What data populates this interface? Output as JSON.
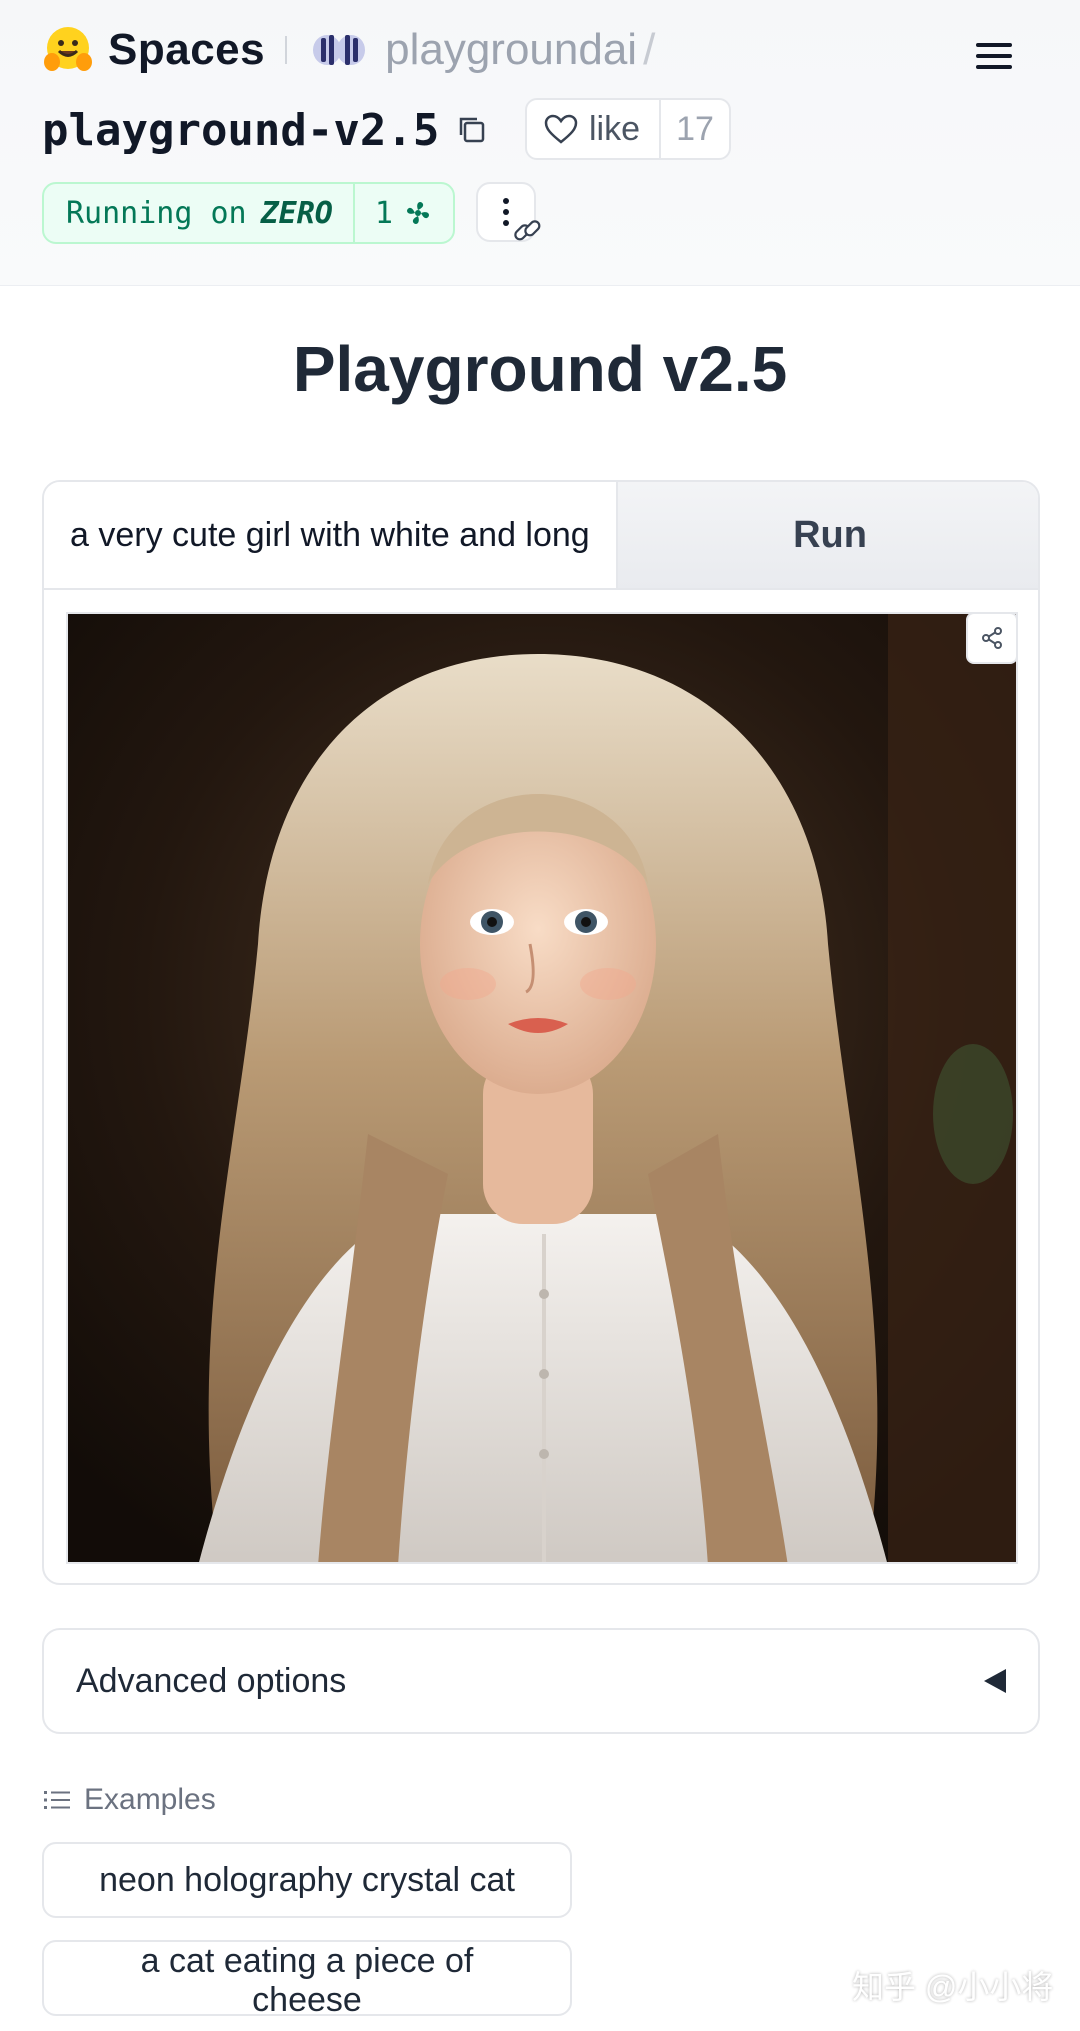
{
  "header": {
    "spaces_label": "Spaces",
    "org_name": "playgroundai",
    "separator": "/",
    "repo_name": "playground-v2.5",
    "like_label": "like",
    "like_count": "17",
    "status": {
      "running_label": "Running on",
      "hardware": "ZERO",
      "replicas": "1"
    }
  },
  "main": {
    "title": "Playground v2.5",
    "prompt_value": "a very cute girl with white and long",
    "run_label": "Run",
    "advanced_label": "Advanced options",
    "examples_label": "Examples",
    "examples": [
      "neon holography crystal cat",
      "a cat eating a piece of cheese"
    ]
  },
  "watermark": "知乎 @小小将",
  "icons": {
    "logo": "hugging-face-icon",
    "org_logo": "playground-org-icon",
    "menu": "hamburger-menu-icon",
    "copy": "copy-icon",
    "like": "heart-icon",
    "replicas": "fan-icon",
    "more": "more-vertical-icon",
    "link": "link-icon",
    "share": "share-icon",
    "advanced_toggle": "caret-left-icon",
    "examples": "list-icon"
  },
  "colors": {
    "running_bg": "#ecfdf5",
    "running_text": "#047857",
    "run_button_bg": "#eef0f3",
    "text_primary": "#1f2937"
  }
}
